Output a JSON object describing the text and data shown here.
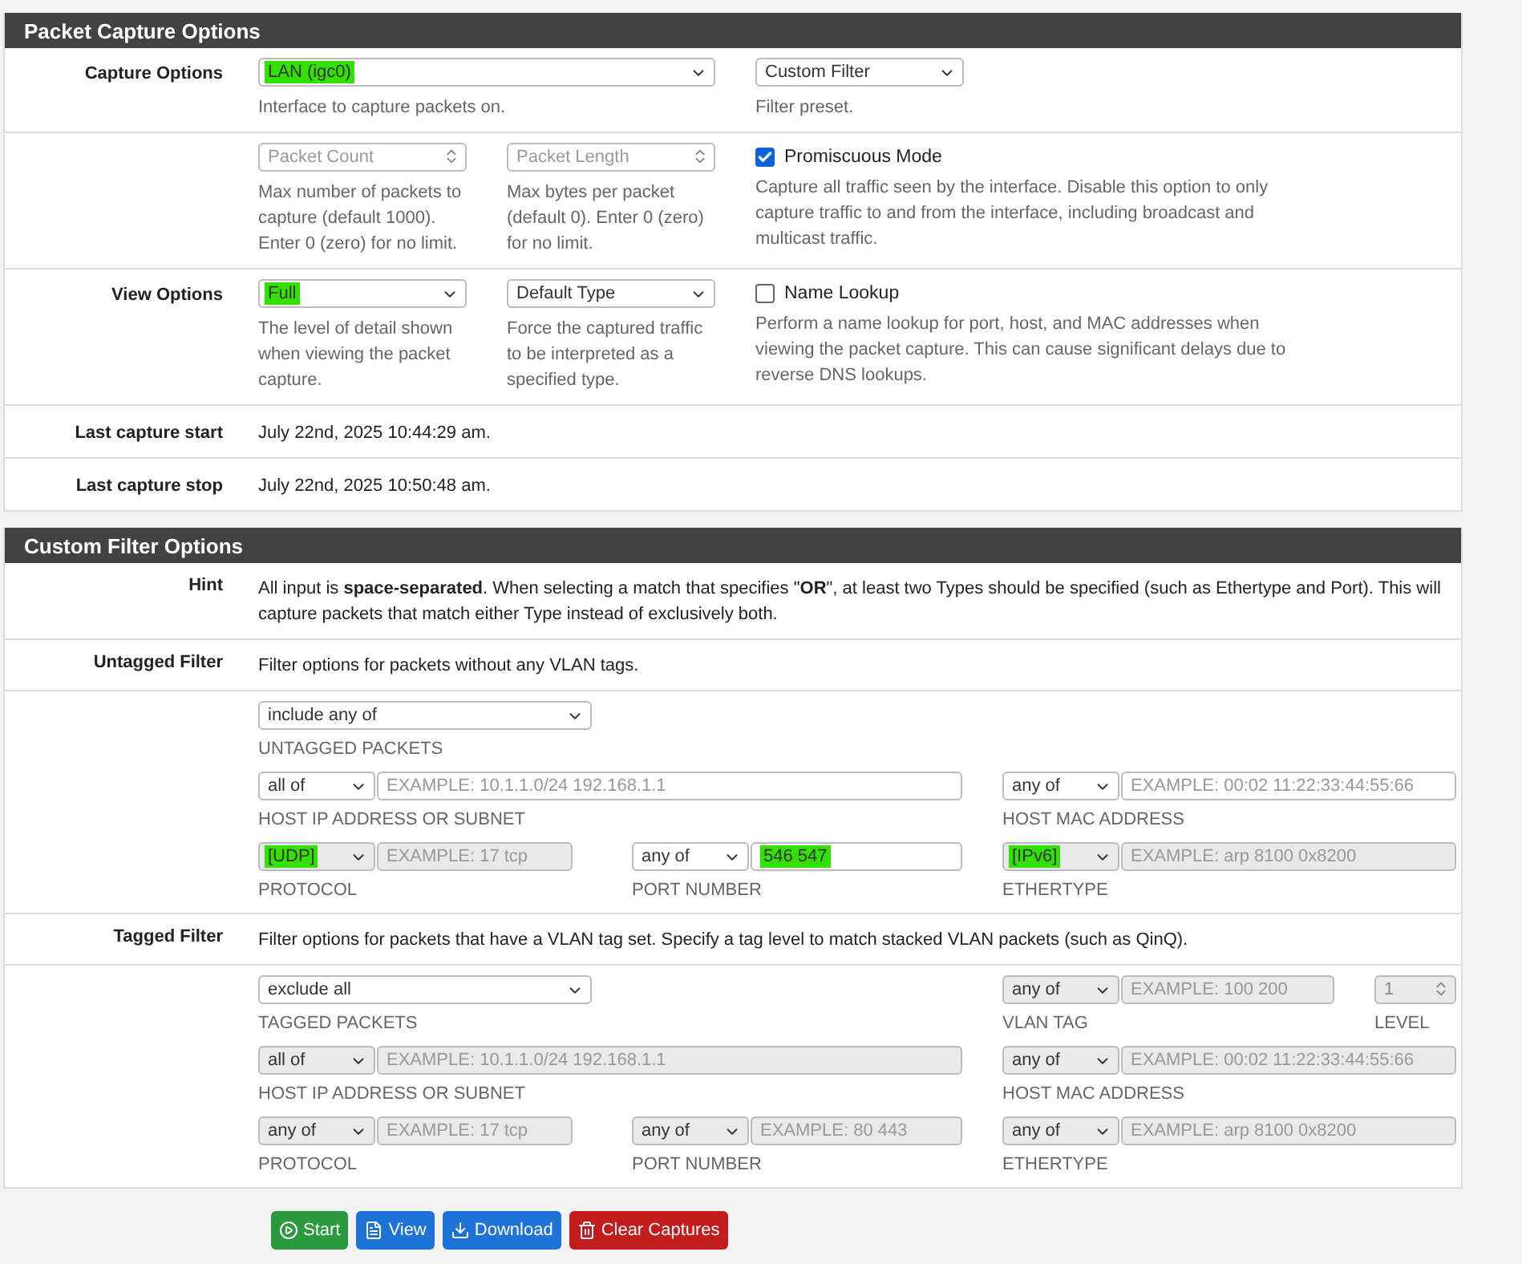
{
  "capture_panel": {
    "title": "Packet Capture Options",
    "interface": {
      "label": "Capture Options",
      "value": "LAN (igc0)",
      "highlighted": true,
      "help": "Interface to capture packets on."
    },
    "filter_preset": {
      "value": "Custom Filter",
      "highlighted": false,
      "help": "Filter preset."
    },
    "packet_count": {
      "placeholder": "Packet Count",
      "help": "Max number of packets to capture (default 1000). Enter 0 (zero) for no limit."
    },
    "packet_length": {
      "placeholder": "Packet Length",
      "help": "Max bytes per packet (default 0). Enter 0 (zero) for no limit."
    },
    "promiscuous": {
      "label": "Promiscuous Mode",
      "checked": true,
      "help": "Capture all traffic seen by the interface. Disable this option to only capture traffic to and from the interface, including broadcast and multicast traffic."
    },
    "view_options": {
      "label": "View Options",
      "value": "Full",
      "highlighted": true,
      "help": "The level of detail shown when viewing the packet capture."
    },
    "type": {
      "value": "Default Type",
      "highlighted": false,
      "help": "Force the captured traffic to be interpreted as a specified type."
    },
    "name_lookup": {
      "label": "Name Lookup",
      "checked": false,
      "help": "Perform a name lookup for port, host, and MAC addresses when viewing the packet capture. This can cause significant delays due to reverse DNS lookups."
    },
    "info_rows": [
      {
        "label": "Last capture start",
        "value": "July 22nd, 2025 10:44:29 am."
      },
      {
        "label": "Last capture stop",
        "value": "July 22nd, 2025 10:50:48 am."
      }
    ]
  },
  "filter_panel": {
    "title": "Custom Filter Options",
    "hint": {
      "label": "Hint",
      "text": "All input is **space-separated**. When selecting a match that specifies \"**OR**\", at least two Types should be specified (such as Ethertype and Port). This will capture packets that match either Type instead of exclusively both."
    },
    "sections": [
      {
        "label": "Untagged Filter",
        "description": "Filter options for packets without any VLAN tags.",
        "rows": [
          [
            {
              "kind": "packets",
              "match": "include any of",
              "highlighted": false,
              "disabled": false,
              "caption": "UNTAGGED PACKETS"
            }
          ],
          [
            {
              "kind": "host",
              "match": "all of",
              "highlighted": false,
              "placeholder": "EXAMPLE: 10.1.1.0/24 192.168.1.1",
              "disabled": false,
              "caption": "HOST IP ADDRESS OR SUBNET"
            },
            "",
            {
              "kind": "mac",
              "match": "any of",
              "highlighted": false,
              "placeholder": "EXAMPLE: 00:02 11:22:33:44:55:66",
              "disabled": false,
              "caption": "HOST MAC ADDRESS"
            }
          ],
          [
            {
              "kind": "protocol",
              "match": "[UDP]",
              "highlighted": true,
              "placeholder": "EXAMPLE: 17 tcp",
              "disabled": true,
              "caption": "PROTOCOL"
            },
            {
              "kind": "port",
              "match": "any of",
              "highlighted": false,
              "value": "546 547",
              "value_highlighted": true,
              "disabled": false,
              "caption": "PORT NUMBER"
            },
            {
              "kind": "ethertype",
              "match": "[IPv6]",
              "highlighted": true,
              "placeholder": "EXAMPLE: arp 8100 0x8200",
              "disabled": true,
              "caption": "ETHERTYPE"
            }
          ]
        ]
      },
      {
        "label": "Tagged Filter",
        "description": "Filter options for packets that have a VLAN tag set. Specify a tag level to match stacked VLAN packets (such as QinQ).",
        "rows": [
          [
            {
              "kind": "packets",
              "match": "exclude all",
              "highlighted": false,
              "disabled": false,
              "caption": "TAGGED PACKETS"
            },
            "",
            {
              "kind": "vlan",
              "match": "any of",
              "highlighted": false,
              "placeholder": "EXAMPLE: 100 200",
              "disabled": true,
              "caption": "VLAN TAG"
            },
            {
              "kind": "level",
              "value": "1",
              "disabled": true,
              "caption": "LEVEL"
            }
          ],
          [
            {
              "kind": "host",
              "match": "all of",
              "highlighted": false,
              "placeholder": "EXAMPLE: 10.1.1.0/24 192.168.1.1",
              "disabled": true,
              "caption": "HOST IP ADDRESS OR SUBNET"
            },
            "",
            {
              "kind": "mac",
              "match": "any of",
              "highlighted": false,
              "placeholder": "EXAMPLE: 00:02 11:22:33:44:55:66",
              "disabled": true,
              "caption": "HOST MAC ADDRESS"
            }
          ],
          [
            {
              "kind": "protocol",
              "match": "any of",
              "highlighted": false,
              "placeholder": "EXAMPLE: 17 tcp",
              "disabled": true,
              "caption": "PROTOCOL"
            },
            {
              "kind": "port",
              "match": "any of",
              "highlighted": false,
              "placeholder": "EXAMPLE: 80 443",
              "disabled": true,
              "caption": "PORT NUMBER"
            },
            {
              "kind": "ethertype",
              "match": "any of",
              "highlighted": false,
              "placeholder": "EXAMPLE: arp 8100 0x8200",
              "disabled": true,
              "caption": "ETHERTYPE"
            }
          ]
        ]
      }
    ]
  },
  "buttons": [
    {
      "kind": "start",
      "label": "Start"
    },
    {
      "kind": "view",
      "label": "View"
    },
    {
      "kind": "download",
      "label": "Download"
    },
    {
      "kind": "clear",
      "label": "Clear Captures"
    }
  ]
}
